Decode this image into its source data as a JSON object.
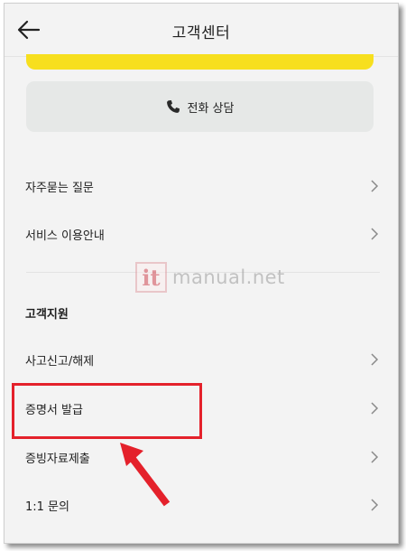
{
  "header": {
    "title": "고객센터",
    "back_icon": "arrow-left-icon"
  },
  "call": {
    "label": "전화 상담",
    "icon": "phone-icon"
  },
  "menu_top": [
    {
      "label": "자주묻는 질문"
    },
    {
      "label": "서비스 이용안내"
    }
  ],
  "section": {
    "title": "고객지원"
  },
  "menu_support": [
    {
      "label": "사고신고/해제"
    },
    {
      "label": "증명서 발급"
    },
    {
      "label": "증빙자료제출"
    },
    {
      "label": "1:1 문의"
    }
  ],
  "watermark": {
    "logo": "it",
    "text": "manual.net"
  },
  "colors": {
    "accent_yellow": "#f7df1e",
    "highlight_red": "#e4212b"
  }
}
